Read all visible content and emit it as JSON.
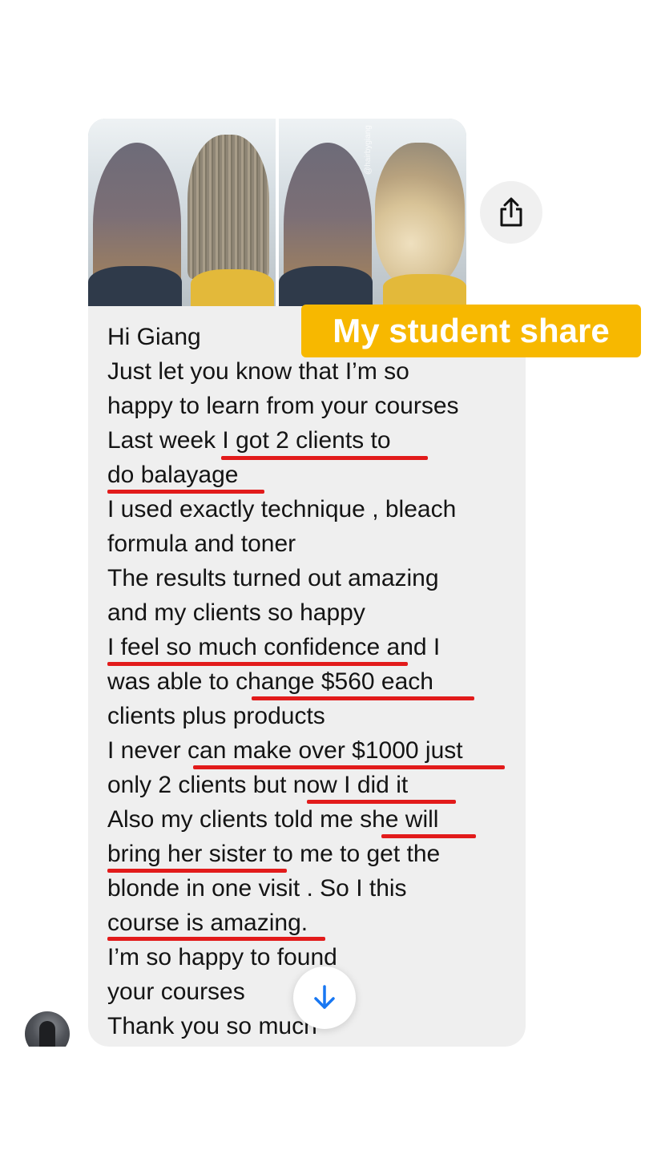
{
  "overlay_label": "My student share",
  "photo_watermark": "@hairbygiang",
  "icons": {
    "share": "share-icon",
    "scroll_down": "arrow-down-icon"
  },
  "colors": {
    "underline": "#e21b1b",
    "label_background": "#f7b800",
    "bubble": "#efefef",
    "scroll_arrow": "#1877f2"
  },
  "message": {
    "lines": [
      "Hi Giang",
      "Just let you know that I’m so",
      "happy to learn from your courses",
      "Last week I got 2 clients to",
      "do balayage",
      "I used exactly technique , bleach",
      "formula and toner",
      "The results turned out amazing",
      "and my clients so happy",
      "I feel so much confidence and I",
      "was able to change $560 each",
      "clients plus products",
      "I never can make over $1000 just",
      "only 2 clients but now I did it",
      "Also my clients told me she will",
      "bring her sister to me to get the",
      "blonde in one visit . So I this",
      "course is amazing.",
      "I’m so happy to found",
      "your courses",
      "Thank you so much"
    ]
  }
}
